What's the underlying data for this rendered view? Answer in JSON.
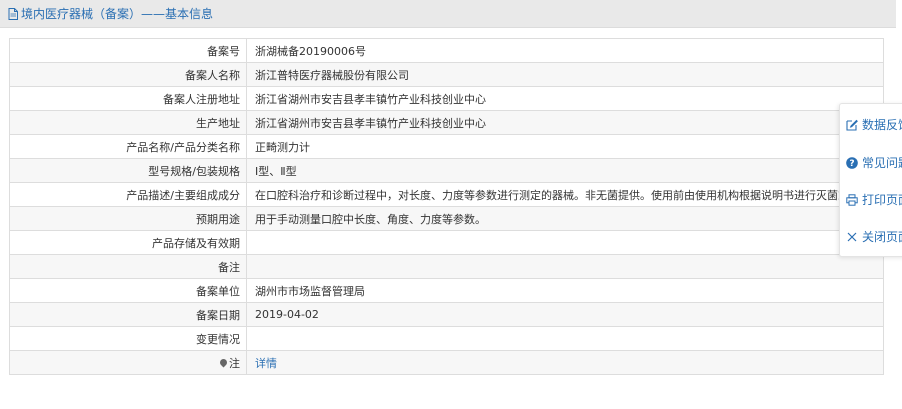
{
  "header": {
    "title": "境内医疗器械（备案）——基本信息",
    "icon": "document-icon"
  },
  "rows": [
    {
      "label": "备案号",
      "value": "浙湖械备20190006号"
    },
    {
      "label": "备案人名称",
      "value": "浙江普特医疗器械股份有限公司"
    },
    {
      "label": "备案人注册地址",
      "value": "浙江省湖州市安吉县孝丰镇竹产业科技创业中心"
    },
    {
      "label": "生产地址",
      "value": "浙江省湖州市安吉县孝丰镇竹产业科技创业中心"
    },
    {
      "label": "产品名称/产品分类名称",
      "value": "正畸测力计"
    },
    {
      "label": "型号规格/包装规格",
      "value": "Ⅰ型、Ⅱ型"
    },
    {
      "label": "产品描述/主要组成成分",
      "value": "在口腔科治疗和诊断过程中，对长度、力度等参数进行测定的器械。非无菌提供。使用前由使用机构根据说明书进行灭菌或消毒"
    },
    {
      "label": "预期用途",
      "value": "用于手动测量口腔中长度、角度、力度等参数。"
    },
    {
      "label": "产品存储及有效期",
      "value": ""
    },
    {
      "label": "备注",
      "value": ""
    },
    {
      "label": "备案单位",
      "value": "湖州市市场监督管理局"
    },
    {
      "label": "备案日期",
      "value": "2019-04-02"
    },
    {
      "label": "变更情况",
      "value": ""
    },
    {
      "label": "注",
      "value": "详情",
      "icon": "pin-icon",
      "link": true
    }
  ],
  "side_panel": {
    "items": [
      {
        "label": "数据反馈",
        "icon": "edit-icon"
      },
      {
        "label": "常见问题",
        "icon": "question-icon"
      },
      {
        "label": "打印页面",
        "icon": "print-icon"
      },
      {
        "label": "关闭页面",
        "icon": "close-icon"
      }
    ]
  },
  "colors": {
    "link": "#2a6fb3",
    "header_bg": "#e9e9e9",
    "row_alt_bg": "#f7f7f7",
    "border": "#dddddd"
  }
}
